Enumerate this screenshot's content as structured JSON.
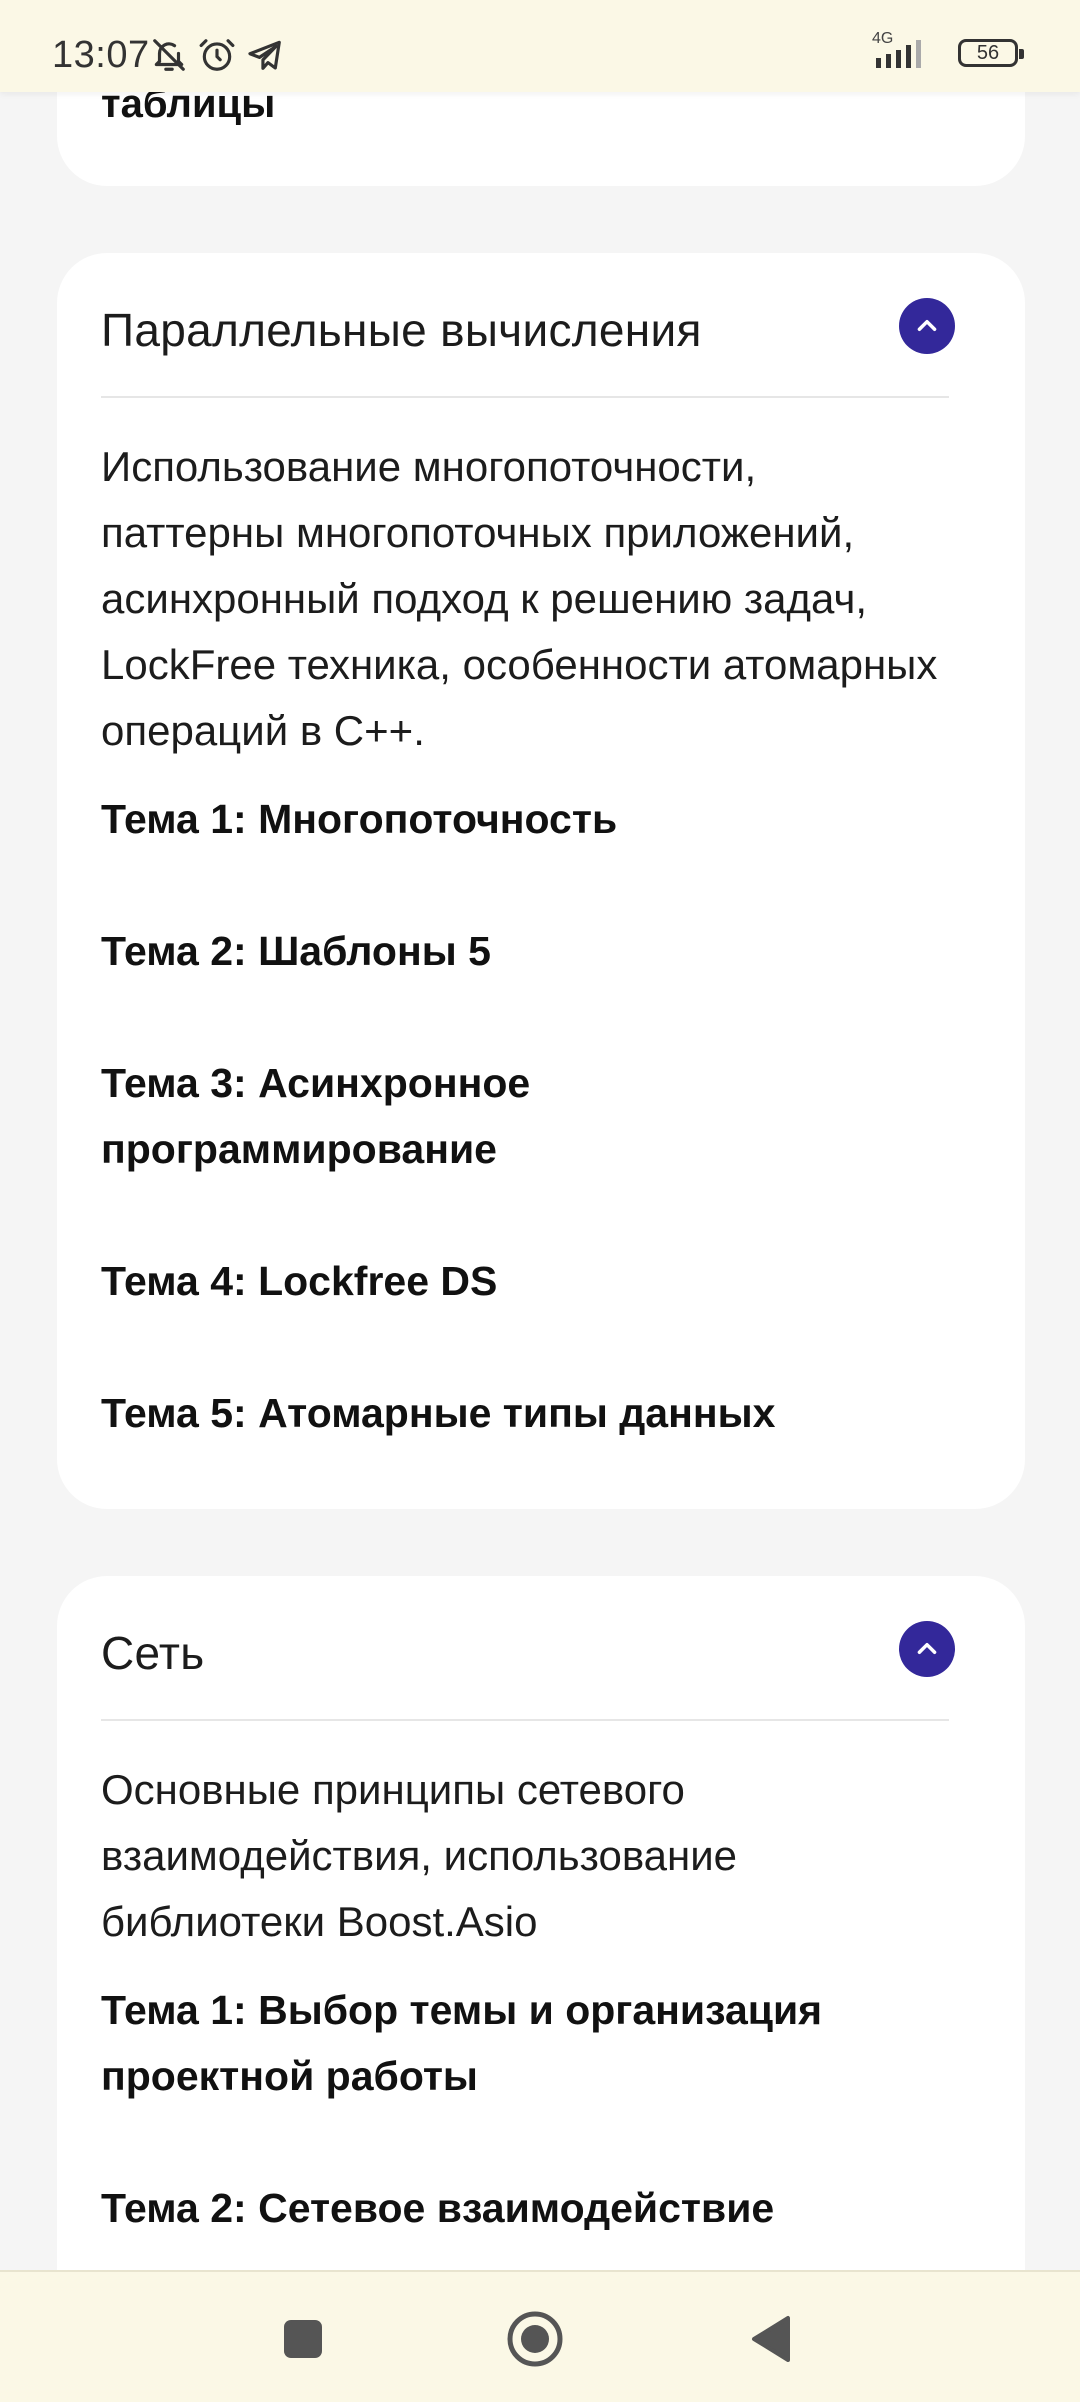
{
  "status_bar": {
    "time": "13:07",
    "network": "4G",
    "battery": "56",
    "icons": [
      "bell-off-icon",
      "alarm-icon",
      "telegram-icon",
      "signal-icon",
      "battery-icon"
    ]
  },
  "prev_card": {
    "title_tail": "таблицы"
  },
  "sections": [
    {
      "title": "Параллельные вычисления",
      "expanded": true,
      "description": "Использование многопоточности, паттерны многопоточных приложений, асинхронный подход к решению задач, LockFree техника, особенности атомарных операций в C++.",
      "topics": [
        "Тема 1: Многопоточность",
        "Тема 2: Шаблоны 5",
        "Тема 3: Асинхронное программирование",
        "Тема 4: Lockfree DS",
        "Тема 5: Атомарные типы данных"
      ]
    },
    {
      "title": "Сеть",
      "expanded": true,
      "description": "Основные принципы сетевого взаимодействия, использование библиотеки Boost.Asio",
      "topics": [
        "Тема 1: Выбор темы и организация проектной работы",
        "Тема 2: Сетевое взаимодействие"
      ]
    }
  ],
  "colors": {
    "accent": "#33289a",
    "card_bg": "#ffffff",
    "page_bg": "#f5f5f5",
    "system_bar_bg": "#fbf8e6"
  },
  "nav_bar": {
    "buttons": [
      "recents-square-icon",
      "home-circle-icon",
      "back-triangle-icon"
    ]
  }
}
